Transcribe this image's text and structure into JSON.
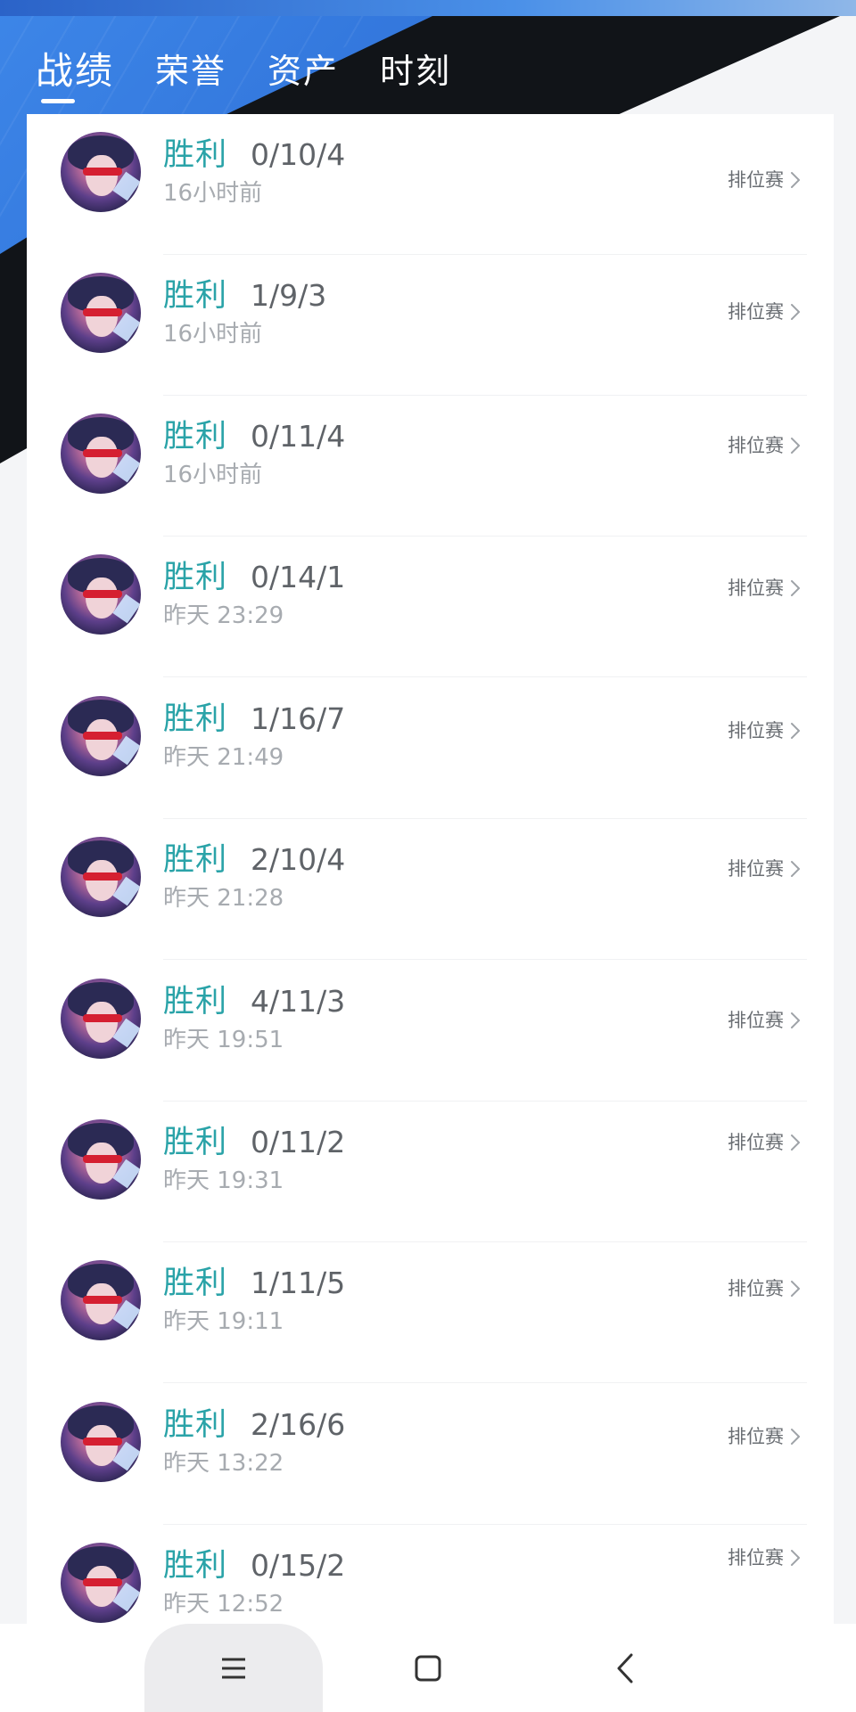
{
  "tabs": [
    {
      "label": "战绩",
      "active": true
    },
    {
      "label": "荣誉",
      "active": false
    },
    {
      "label": "资产",
      "active": false
    },
    {
      "label": "时刻",
      "active": false
    }
  ],
  "matches": [
    {
      "result": "胜利",
      "kda": "0/10/4",
      "time": "16小时前",
      "mode": "排位赛"
    },
    {
      "result": "胜利",
      "kda": "1/9/3",
      "time": "16小时前",
      "mode": "排位赛"
    },
    {
      "result": "胜利",
      "kda": "0/11/4",
      "time": "16小时前",
      "mode": "排位赛"
    },
    {
      "result": "胜利",
      "kda": "0/14/1",
      "time": "昨天 23:29",
      "mode": "排位赛"
    },
    {
      "result": "胜利",
      "kda": "1/16/7",
      "time": "昨天 21:49",
      "mode": "排位赛"
    },
    {
      "result": "胜利",
      "kda": "2/10/4",
      "time": "昨天 21:28",
      "mode": "排位赛"
    },
    {
      "result": "胜利",
      "kda": "4/11/3",
      "time": "昨天 19:51",
      "mode": "排位赛"
    },
    {
      "result": "胜利",
      "kda": "0/11/2",
      "time": "昨天 19:31",
      "mode": "排位赛"
    },
    {
      "result": "胜利",
      "kda": "1/11/5",
      "time": "昨天 19:11",
      "mode": "排位赛"
    },
    {
      "result": "胜利",
      "kda": "2/16/6",
      "time": "昨天 13:22",
      "mode": "排位赛"
    },
    {
      "result": "胜利",
      "kda": "0/15/2",
      "time": "昨天 12:52",
      "mode": "排位赛"
    }
  ],
  "navbar": {
    "buttons": [
      {
        "icon": "menu-icon"
      },
      {
        "icon": "home-square-icon"
      },
      {
        "icon": "back-icon"
      }
    ]
  },
  "colors": {
    "accent_win": "#2aa3a8",
    "header_blue": "#3174da",
    "header_black": "#111418"
  }
}
